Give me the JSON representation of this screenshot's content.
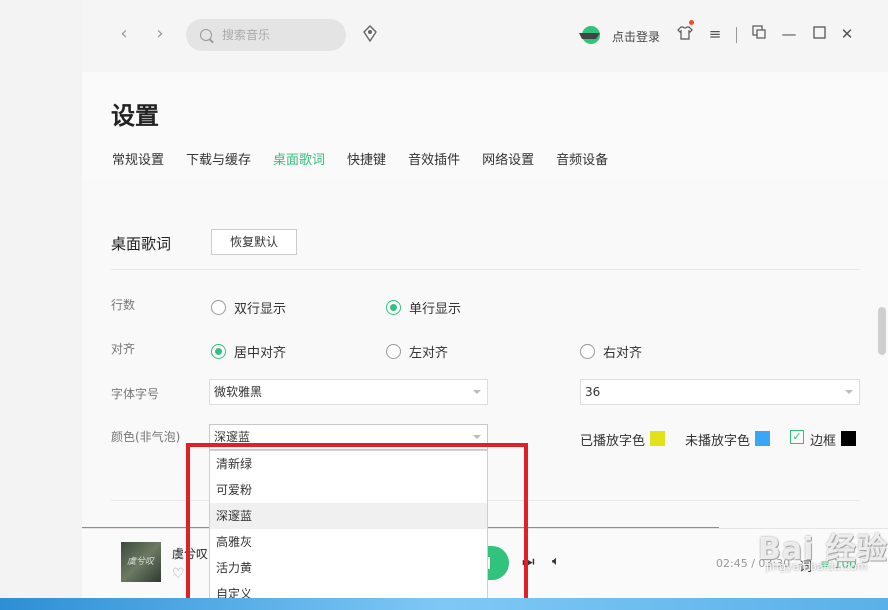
{
  "titlebar": {
    "search_placeholder": "搜索音乐",
    "login_label": "点击登录"
  },
  "page": {
    "title": "设置",
    "tabs": [
      {
        "label": "常规设置"
      },
      {
        "label": "下载与缓存"
      },
      {
        "label": "桌面歌词",
        "active": true
      },
      {
        "label": "快捷键"
      },
      {
        "label": "音效插件"
      },
      {
        "label": "网络设置"
      },
      {
        "label": "音频设备"
      }
    ]
  },
  "desktop_lyrics": {
    "section_title": "桌面歌词",
    "restore_default_label": "恢复默认",
    "rows": {
      "lines_label": "行数",
      "align_label": "对齐",
      "font_label": "字体字号",
      "color_label": "颜色(非气泡)"
    },
    "lines_options": [
      {
        "label": "双行显示",
        "checked": false
      },
      {
        "label": "单行显示",
        "checked": true
      }
    ],
    "align_options": [
      {
        "label": "居中对齐",
        "checked": true
      },
      {
        "label": "左对齐",
        "checked": false
      },
      {
        "label": "右对齐",
        "checked": false
      }
    ],
    "font_family_value": "微软雅黑",
    "font_size_value": "36",
    "color_scheme_value": "深邃蓝",
    "played_color_label": "已播放字色",
    "played_color": "#e2e21a",
    "unplayed_color_label": "未播放字色",
    "unplayed_color": "#3aa6f5",
    "border_label": "边框",
    "border_checked": true,
    "border_color": "#000000",
    "color_scheme_options": [
      "清新绿",
      "可爱粉",
      "深邃蓝",
      "高雅灰",
      "活力黄",
      "自定义"
    ],
    "hovered_option": "深邃蓝"
  },
  "player": {
    "song_title": "虞兮叹",
    "time": "02:45 / 03:30",
    "lyric_label": "词",
    "playlist_count": "100",
    "progress_fraction": 0.79
  },
  "watermark": {
    "brand": "Bai 经验",
    "url": "jingyan.baidu.com"
  },
  "colors": {
    "accent": "#31c27c",
    "highlight_box": "#e21f26"
  }
}
